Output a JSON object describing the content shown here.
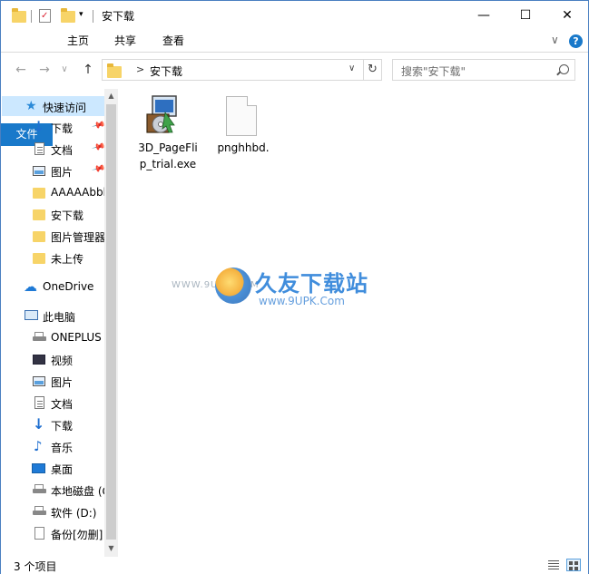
{
  "window": {
    "title": "安下载"
  },
  "window_controls": {
    "minimize": "—",
    "maximize": "☐",
    "close": "✕"
  },
  "ribbon": {
    "tabs": [
      {
        "label": "文件"
      },
      {
        "label": "主页"
      },
      {
        "label": "共享"
      },
      {
        "label": "查看"
      }
    ],
    "collapse_glyph": "∨",
    "help_glyph": "?"
  },
  "nav_buttons": {
    "back": "←",
    "forward": "→",
    "recent": "∨",
    "up": "↑"
  },
  "address": {
    "chevron": ">",
    "path": "安下载",
    "dropdown": "∨",
    "refresh": "↻"
  },
  "search": {
    "placeholder": "搜索\"安下载\""
  },
  "sidebar": {
    "items": [
      {
        "label": "快速访问",
        "icon": "star-icon"
      },
      {
        "label": "下载",
        "icon": "download-icon",
        "pinned": true
      },
      {
        "label": "文档",
        "icon": "document-icon",
        "pinned": true
      },
      {
        "label": "图片",
        "icon": "picture-icon",
        "pinned": true
      },
      {
        "label": "AAAAAbbb",
        "icon": "folder-icon"
      },
      {
        "label": "安下载",
        "icon": "folder-icon"
      },
      {
        "label": "图片管理器",
        "icon": "folder-icon"
      },
      {
        "label": "未上传",
        "icon": "folder-icon"
      },
      {
        "label": "OneDrive",
        "icon": "cloud-icon"
      },
      {
        "label": "此电脑",
        "icon": "computer-icon"
      },
      {
        "label": "ONEPLUS",
        "icon": "device-icon"
      },
      {
        "label": "视频",
        "icon": "video-icon"
      },
      {
        "label": "图片",
        "icon": "picture-icon"
      },
      {
        "label": "文档",
        "icon": "document-icon"
      },
      {
        "label": "下载",
        "icon": "download-icon"
      },
      {
        "label": "音乐",
        "icon": "music-icon"
      },
      {
        "label": "桌面",
        "icon": "desktop-icon"
      },
      {
        "label": "本地磁盘 (C",
        "icon": "drive-icon"
      },
      {
        "label": "软件 (D:)",
        "icon": "drive-icon"
      },
      {
        "label": "备份[勿删]",
        "icon": "file-icon"
      }
    ],
    "pin_glyph": "📌",
    "scroll_up": "▲",
    "scroll_down": "▼"
  },
  "files": [
    {
      "name": "3D_PageFlip_trial.exe",
      "line1": "3D_PageFli",
      "line2": "p_trial.exe",
      "icon": "installer-icon"
    },
    {
      "name": "pnghhbd.",
      "line1": "pnghhbd.",
      "line2": "",
      "icon": "blank-file-icon"
    }
  ],
  "watermark": {
    "www": "WWW.9UPK.COM",
    "title": "久友下载站",
    "url": "www.9UPK.Com"
  },
  "status": {
    "count": "3 个项目"
  }
}
